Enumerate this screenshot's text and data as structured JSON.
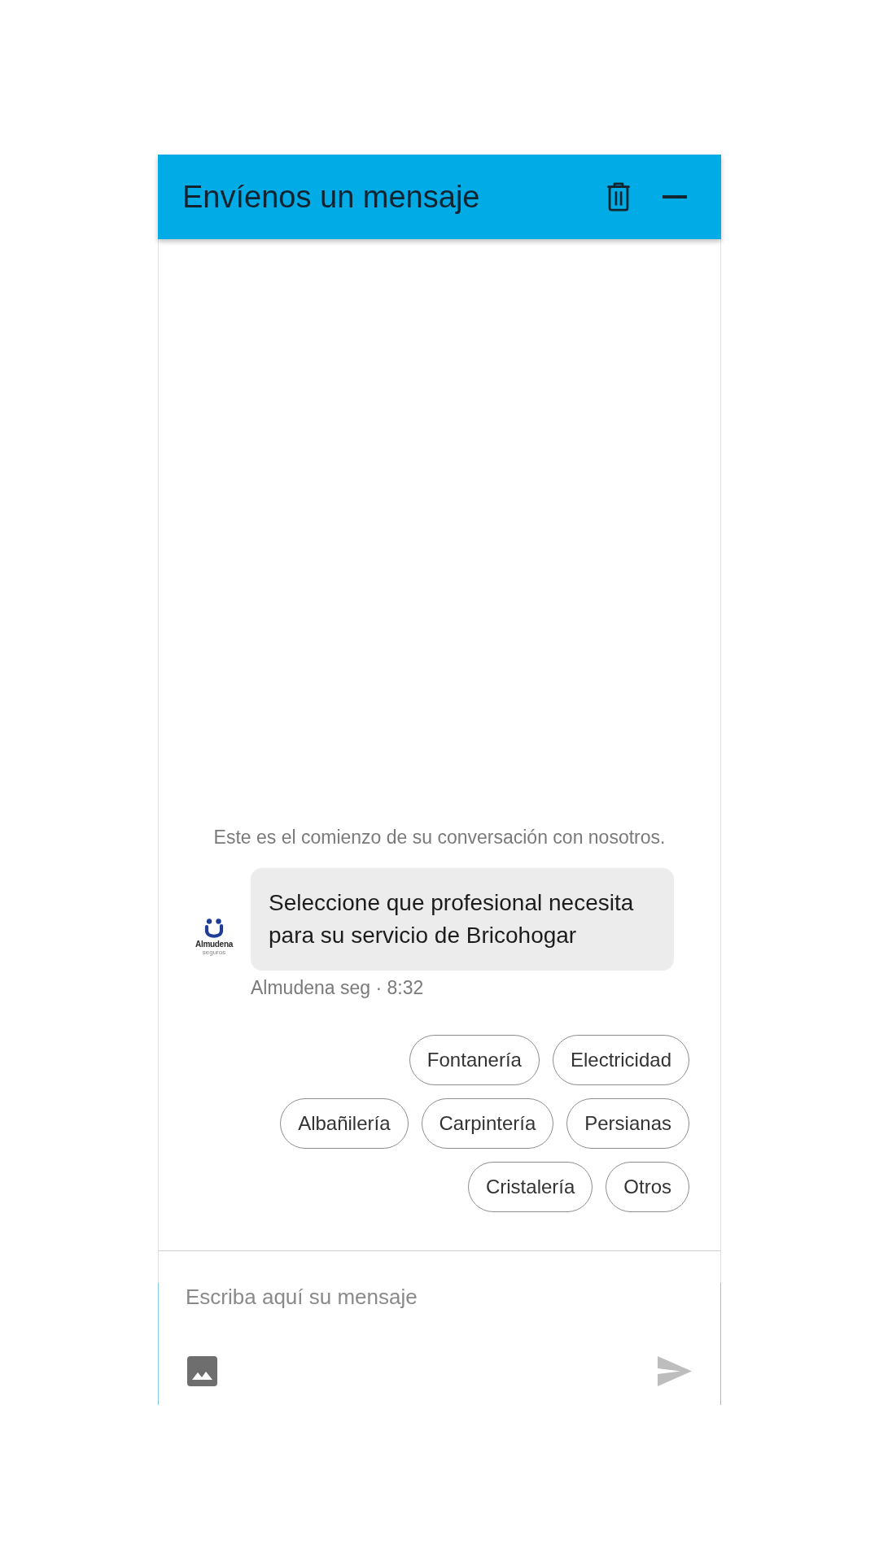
{
  "header": {
    "title": "Envíenos un mensaje"
  },
  "conversation": {
    "intro": "Este es el comienzo de su conversación con nosotros.",
    "messages": [
      {
        "sender_logo": {
          "name": "Almudena",
          "tagline": "seguros"
        },
        "text": "Seleccione que profesional necesita para su servicio de Bricohogar",
        "meta": "Almudena seg · 8:32"
      }
    ],
    "quick_replies": [
      "Fontanería",
      "Electricidad",
      "Albañilería",
      "Carpintería",
      "Persianas",
      "Cristalería",
      "Otros"
    ]
  },
  "composer": {
    "placeholder": "Escriba aquí su mensaje"
  }
}
